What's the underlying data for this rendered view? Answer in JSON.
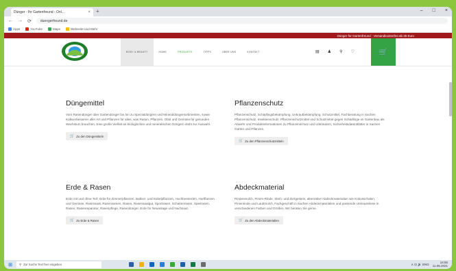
{
  "browser": {
    "tab_title": "Dünger - Ihr Gartenfreund - Onl...",
    "tab_close": "×",
    "new_tab": "+",
    "window_controls": [
      "–",
      "□",
      "×"
    ],
    "nav_back": "←",
    "nav_forward": "→",
    "reload": "⟳",
    "url": "duengerfreund.de",
    "bookmarks": [
      {
        "label": "Apps",
        "color": "#4285f4"
      },
      {
        "label": "YouTube",
        "color": "#e62117"
      },
      {
        "label": "Maps",
        "color": "#34a853"
      },
      {
        "label": "Webseite-und-Mehr",
        "color": "#fbbc05"
      }
    ]
  },
  "site": {
    "topbar_text": "Dünger für Gartenfreund · Versandkostenfrei ab 35 Euro",
    "menu": [
      "BODY & BEAUTY",
      "HOME",
      "PRODUKTE",
      "TIPPS",
      "ÜBER UNS",
      "KONTAKT"
    ],
    "menu_active_index": 0,
    "menu_current_index": 2,
    "nav_icons": [
      "▤",
      "♟",
      "⚲",
      "♡"
    ],
    "cart_icon": "🛒"
  },
  "categories": [
    {
      "title": "Düngemittel",
      "text": "Vom Rasendünger über Gartendünger bis hin zu Spezialdüngern und Mineraldüngersortimenten, sowie Kalkverbesserer aller Art und Pflanzen für alles, was Rasen, Pflanzen, Obst und Gemüse für gesunden Wachstum brauchen. Eine große Vielfalt an biologischen und mineralischen Düngern steht zur Auswahl.",
      "button": "Zu den Düngemitteln"
    },
    {
      "title": "Pflanzenschutz",
      "text": "Pflanzenschutz, Schädlingsbekämpfung, Unkrautbekämpfung, Schutzmittel, Fachberatung in Sachen Pflanzenschutz, Insektenschutz, Pflanzenschutzmittel und Schutzmittel gegen Schädlinge im Gartenbau als Abwehr und Produktinformationen zu Pflanzenschutz und Unkräutern, Sicherheitsdatenblätter in Sachen Garten und Pflanzen.",
      "button": "Zu den Pflanzenschutzmitteln"
    },
    {
      "title": "Erde & Rasen",
      "text": "Erde mit und ohne Torf, Erde für Zimmerpflanzen, Balkon- und Kübelpflanzen, Hochbeeterden, Hortflanzen und Gemüse, Rasensaat, Rasensamen, Rasen, Rasensaatgut, Sportrasen, Schattenrasen, Spielrasen, Rasen, Rasenreparatur, Rasenpflege, Rasendünger, Erde für Neuanlage und Nachsaat.",
      "button": "Zu Erde & Rasen"
    },
    {
      "title": "Abdeckmaterial",
      "text": "Rindenmulch, Pinien-Rinde, Stein- und Ziergestein, alternative Abdeckmaterialien wie Kokosschalen, Pinienrinde und Laubmulch, Fachgeschäft in Sachen Abdeckmaterialien und passende Unkrautvliese in verschiedenen Farben und Größen. Wir beraten Sie gerne.",
      "button": "Zu den Abdeckmaterialien"
    }
  ],
  "taskbar": {
    "start_icon": "⊞",
    "search_placeholder": "Zur Suche Text hier eingeben",
    "app_colors": [
      "#2c5fa8",
      "#f0b400",
      "#0a66c2",
      "#2b7bd8",
      "#3aa835",
      "#1e5faa",
      "#0f7b43",
      "#6b6b6b"
    ],
    "tray_text": "∧ ⊡ 🔊 ENG",
    "time": "14:55",
    "date": "11.05.2021"
  }
}
